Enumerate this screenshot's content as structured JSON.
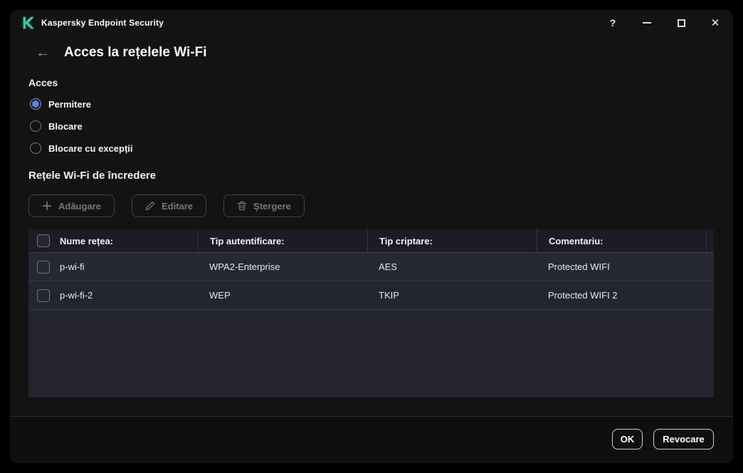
{
  "window": {
    "title": "Kaspersky Endpoint Security",
    "controls": {
      "help": "?",
      "minimize": "minimize",
      "maximize": "maximize",
      "close": "✕"
    }
  },
  "page": {
    "back_glyph": "←",
    "title": "Acces la rețelele Wi-Fi"
  },
  "access_section": {
    "heading": "Acces",
    "options": [
      {
        "label": "Permitere",
        "selected": true
      },
      {
        "label": "Blocare",
        "selected": false
      },
      {
        "label": "Blocare cu excepții",
        "selected": false
      }
    ]
  },
  "trusted_section": {
    "heading": "Rețele Wi-Fi de încredere",
    "toolbar": [
      {
        "label": "Adăugare",
        "icon": "plus-icon"
      },
      {
        "label": "Editare",
        "icon": "pencil-icon"
      },
      {
        "label": "Ștergere",
        "icon": "trash-icon"
      }
    ]
  },
  "table": {
    "columns": [
      "Nume rețea:",
      "Tip autentificare:",
      "Tip criptare:",
      "Comentariu:"
    ],
    "rows": [
      {
        "name": "p-wi-fi",
        "auth": "WPA2-Enterprise",
        "encryption": "AES",
        "comment": "Protected WIFI"
      },
      {
        "name": "p-wi-fi-2",
        "auth": "WEP",
        "encryption": "TKIP",
        "comment": "Protected WIFI 2"
      }
    ]
  },
  "footer": {
    "ok": "OK",
    "cancel": "Revocare"
  },
  "colors": {
    "brand_teal": "#23d1a8",
    "radio_selected": "#5a85ee",
    "window_bg": "#131314",
    "table_bg": "#23242e",
    "table_header_bg": "#1b1c25",
    "row_bg": "#252732",
    "footer_bg": "#0f0f12"
  }
}
